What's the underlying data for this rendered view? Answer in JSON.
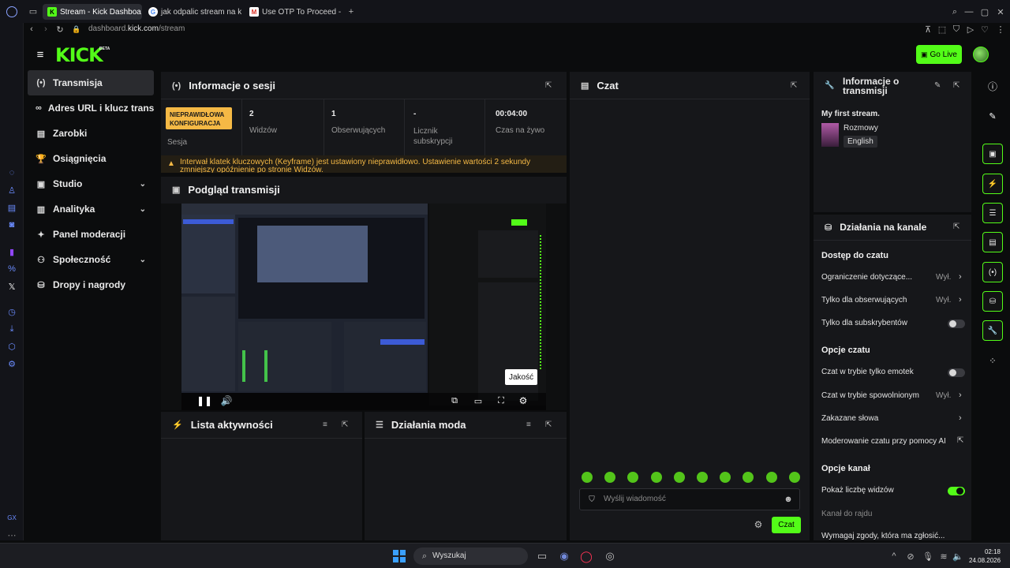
{
  "browser": {
    "tabs": [
      {
        "label": "Stream - Kick Dashboa",
        "active": true
      },
      {
        "label": "jak odpalic stream na kick",
        "active": false
      },
      {
        "label": "Use OTP To Proceed - ulec",
        "active": false
      }
    ],
    "url_prefix": "dashboard.",
    "url_domain": "kick.com",
    "url_path": "/stream"
  },
  "header": {
    "logo": "KICK",
    "beta": "BETA",
    "go_live": "Go Live"
  },
  "sidebar": {
    "items": [
      {
        "label": "Transmisja",
        "icon": "(•)",
        "active": true,
        "chevron": false
      },
      {
        "label": "Adres URL i klucz transmisji",
        "icon": "∞",
        "active": false,
        "chevron": false
      },
      {
        "label": "Zarobki",
        "icon": "▤",
        "active": false,
        "chevron": false
      },
      {
        "label": "Osiągnięcia",
        "icon": "🏆",
        "active": false,
        "chevron": false
      },
      {
        "label": "Studio",
        "icon": "▣",
        "active": false,
        "chevron": true
      },
      {
        "label": "Analityka",
        "icon": "▥",
        "active": false,
        "chevron": true
      },
      {
        "label": "Panel moderacji",
        "icon": "✦",
        "active": false,
        "chevron": false
      },
      {
        "label": "Społeczność",
        "icon": "⚇",
        "active": false,
        "chevron": true
      },
      {
        "label": "Dropy i nagrody",
        "icon": "⛁",
        "active": false,
        "chevron": false
      }
    ]
  },
  "session": {
    "title": "Informacje o sesji",
    "badge": "NIEPRAWIDŁOWA KONFIGURACJA",
    "badge_label": "Sesja",
    "stats": [
      {
        "value": "2",
        "label": "Widzów"
      },
      {
        "value": "1",
        "label": "Obserwujących"
      },
      {
        "value": "-",
        "label": "Licznik subskrypcji"
      },
      {
        "value": "00:04:00",
        "label": "Czas na żywo"
      }
    ],
    "warning": "Interwał klatek kluczowych (Keyframe) jest ustawiony nieprawidłowo. Ustawienie wartości 2 sekundy zmniejszy opóźnienie po stronie Widzów."
  },
  "preview": {
    "title": "Podgląd transmisji",
    "tooltip": "Jakość"
  },
  "activity": {
    "title": "Lista aktywności"
  },
  "mod": {
    "title": "Działania moda"
  },
  "chat": {
    "title": "Czat",
    "placeholder": "Wyślij wiadomość",
    "send": "Czat"
  },
  "stream_info": {
    "title": "Informacje o transmisji",
    "stream_title": "My first stream.",
    "category": "Rozmowy",
    "language": "English"
  },
  "channel_actions": {
    "title": "Działania na kanale",
    "section1": "Dostęp do czatu",
    "row_limit": "Ograniczenie dotyczące...",
    "row_followers": "Tylko dla obserwujących",
    "value_off": "Wył.",
    "row_subs": "Tylko dla subskrybentów",
    "section2": "Opcje czatu",
    "row_emotes": "Czat w trybie tylko emotek",
    "row_slow": "Czat w trybie spowolnionym",
    "row_banned": "Zakazane słowa",
    "row_ai": "Moderowanie czatu przy pomocy AI",
    "section3": "Opcje kanał",
    "row_viewers": "Pokaż liczbę widzów",
    "row_raid": "Kanał do rajdu",
    "row_cut": "Wymagaj zgody, która ma zgłosić..."
  },
  "taskbar": {
    "search": "Wyszukaj",
    "time": "02:18",
    "date": "24.08.2026"
  },
  "colors": {
    "accent": "#53fc18",
    "warning": "#f5b945"
  }
}
